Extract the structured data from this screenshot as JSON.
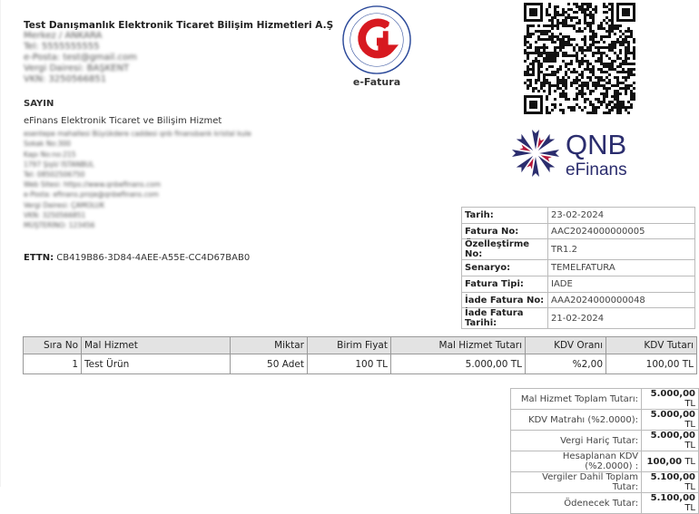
{
  "seller": {
    "name": "Test Danışmanlık Elektronik Ticaret Bilişim Hizmetleri A.Ş",
    "lines": [
      "Merkez / ANKARA",
      "Tel: 5555555555",
      "e-Posta: test@gmail.com",
      "Vergi Dairesi: BAŞKENT",
      "VKN: 3250566851"
    ]
  },
  "logo": {
    "label": "e-Fatura"
  },
  "buyer": {
    "title": "SAYIN",
    "name": "eFinans Elektronik Ticaret ve Bilişim Hizmet",
    "lines": [
      "esentepe mahallesi Büyükdere caddesi qnb finansbank kristal kule",
      "Sokak No:300",
      "Kapı No:no:215",
      "1797 Şişli/ İSTANBUL",
      "Tel: 08502506750",
      "Web Sitesi: https://www.qnbefinans.com",
      "e-Posta: efinans.proje@qnbefinans.com",
      "Vergi Dairesi: ÇAMOLUK",
      "VKN: 3250566851",
      "MÜŞTERİNO: 123456"
    ]
  },
  "ettn": {
    "label": "ETTN:",
    "value": "CB419B86-3D84-4AEE-A55E-CC4D67BAB0"
  },
  "qnb": {
    "brand": "QNB",
    "sub": "eFinans"
  },
  "info": [
    {
      "k": "Tarih:",
      "v": "23-02-2024"
    },
    {
      "k": "Fatura No:",
      "v": "AAC2024000000005"
    },
    {
      "k": "Özelleştirme No:",
      "v": "TR1.2"
    },
    {
      "k": "Senaryo:",
      "v": "TEMELFATURA"
    },
    {
      "k": "Fatura Tipi:",
      "v": "IADE"
    },
    {
      "k": "İade Fatura No:",
      "v": "AAA2024000000048"
    },
    {
      "k": "İade Fatura Tarihi:",
      "v": "21-02-2024"
    }
  ],
  "items": {
    "headers": [
      "Sıra No",
      "Mal Hizmet",
      "Miktar",
      "Birim Fiyat",
      "Mal Hizmet Tutarı",
      "KDV Oranı",
      "KDV Tutarı"
    ],
    "rows": [
      [
        "1",
        "Test Ürün",
        "50 Adet",
        "100 TL",
        "5.000,00 TL",
        "%2,00",
        "100,00 TL"
      ]
    ]
  },
  "totals": [
    {
      "k": "Mal Hizmet Toplam Tutarı:",
      "v": "5.000,00",
      "u": "TL"
    },
    {
      "k": "KDV Matrahı (%2.0000):",
      "v": "5.000,00",
      "u": "TL"
    },
    {
      "k": "Vergi Hariç Tutar:",
      "v": "5.000,00",
      "u": "TL"
    },
    {
      "k": "Hesaplanan KDV (%2.0000) :",
      "v": "100,00",
      "u": "TL"
    },
    {
      "k": "Vergiler Dahil Toplam Tutar:",
      "v": "5.100,00",
      "u": "TL"
    },
    {
      "k": "Ödenecek Tutar:",
      "v": "5.100,00",
      "u": "TL"
    }
  ],
  "colors": {
    "gib_red": "#d71920",
    "gib_blue": "#2c4a9a",
    "qnb_navy": "#2b2d6e",
    "qnb_red": "#b5173a"
  }
}
